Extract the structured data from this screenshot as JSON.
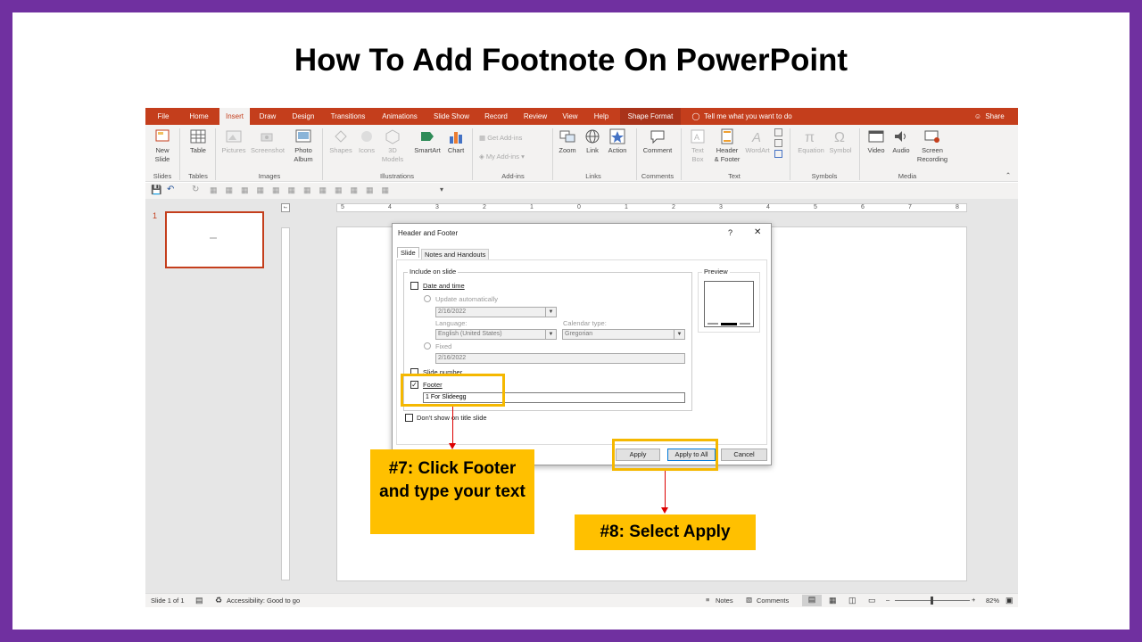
{
  "slide_title": "How To Add Footnote On PowerPoint",
  "menu": {
    "tabs": [
      "File",
      "Home",
      "Insert",
      "Draw",
      "Design",
      "Transitions",
      "Animations",
      "Slide Show",
      "Record",
      "Review",
      "View",
      "Help",
      "Shape Format"
    ],
    "active_tab": "Insert",
    "tell_me": "Tell me what you want to do",
    "share": "Share"
  },
  "ribbon": {
    "new_slide": "New\nSlide",
    "table": "Table",
    "pictures": "Pictures",
    "screenshot": "Screenshot",
    "photo_album": "Photo\nAlbum",
    "shapes": "Shapes",
    "icons": "Icons",
    "models_3d": "3D\nModels",
    "smartart": "SmartArt",
    "chart": "Chart",
    "get_addins": "Get Add-ins",
    "my_addins": "My Add-ins",
    "zoom": "Zoom",
    "link": "Link",
    "action": "Action",
    "comment": "Comment",
    "text_box": "Text\nBox",
    "header_footer": "Header\n& Footer",
    "wordart": "WordArt",
    "equation": "Equation",
    "symbol": "Symbol",
    "video": "Video",
    "audio": "Audio",
    "screen_recording": "Screen\nRecording",
    "groups": {
      "slides": "Slides",
      "tables": "Tables",
      "images": "Images",
      "illustrations": "Illustrations",
      "addins": "Add-ins",
      "links": "Links",
      "comments": "Comments",
      "text": "Text",
      "symbols": "Symbols",
      "media": "Media"
    }
  },
  "thumbnails": {
    "slide_number": "1"
  },
  "ruler_labels": [
    "5",
    "4",
    "3",
    "2",
    "1",
    "0",
    "1",
    "2",
    "3",
    "4",
    "5",
    "6",
    "7",
    "8"
  ],
  "dialog": {
    "title": "Header and Footer",
    "help": "?",
    "close": "✕",
    "tabs": [
      "Slide",
      "Notes and Handouts"
    ],
    "include_on_slide": "Include on slide",
    "date_and_time": "Date and time",
    "update_automatically": "Update automatically",
    "date_value": "2/16/2022",
    "language_label": "Language:",
    "language_value": "English (United States)",
    "calendar_label": "Calendar type:",
    "calendar_value": "Gregorian",
    "fixed": "Fixed",
    "fixed_value": "2/16/2022",
    "slide_number": "Slide number",
    "footer": "Footer",
    "footer_text": "1 For Slideegg",
    "dont_show": "Don't show on title slide",
    "preview": "Preview",
    "apply": "Apply",
    "apply_to_all": "Apply to All",
    "cancel": "Cancel"
  },
  "callouts": {
    "step7": "#7: Click Footer and type your text",
    "step8": "#8: Select Apply"
  },
  "status": {
    "slide_of": "Slide 1 of 1",
    "accessibility": "Accessibility: Good to go",
    "notes": "Notes",
    "comments": "Comments",
    "zoom": "82%"
  },
  "colors": {
    "frame": "#7030a0",
    "menubar": "#c43e1c",
    "highlight": "#f5b800",
    "callout": "#ffc000",
    "arrow": "#d00000"
  }
}
